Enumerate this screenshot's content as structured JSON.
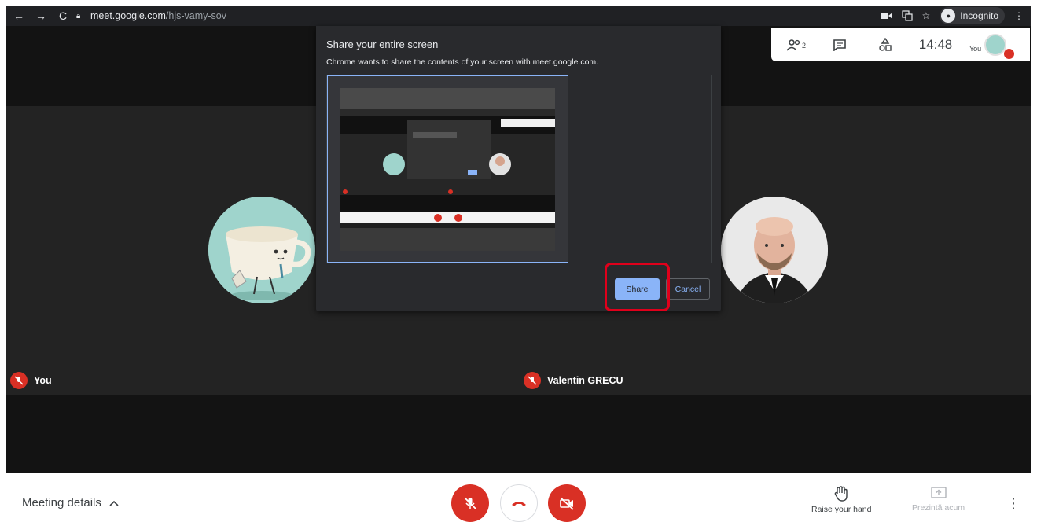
{
  "browser": {
    "url_host": "meet.google.com",
    "url_path": "/hjs-vamy-sov",
    "incognito_label": "Incognito"
  },
  "meet_panel": {
    "participants_count": "2",
    "time": "14:48",
    "you_label": "You"
  },
  "dialog": {
    "title": "Share your entire screen",
    "subtitle": "Chrome wants to share the contents of your screen with meet.google.com.",
    "share_label": "Share",
    "cancel_label": "Cancel"
  },
  "tiles": {
    "self_name": "You",
    "other_name": "Valentin GRECU"
  },
  "bottombar": {
    "meeting_details": "Meeting details",
    "raise_hand": "Raise your hand",
    "present_now": "Prezintă acum"
  },
  "colors": {
    "accent_blue": "#8ab4f8",
    "danger_red": "#d93025",
    "highlight_red": "#e0001b"
  }
}
